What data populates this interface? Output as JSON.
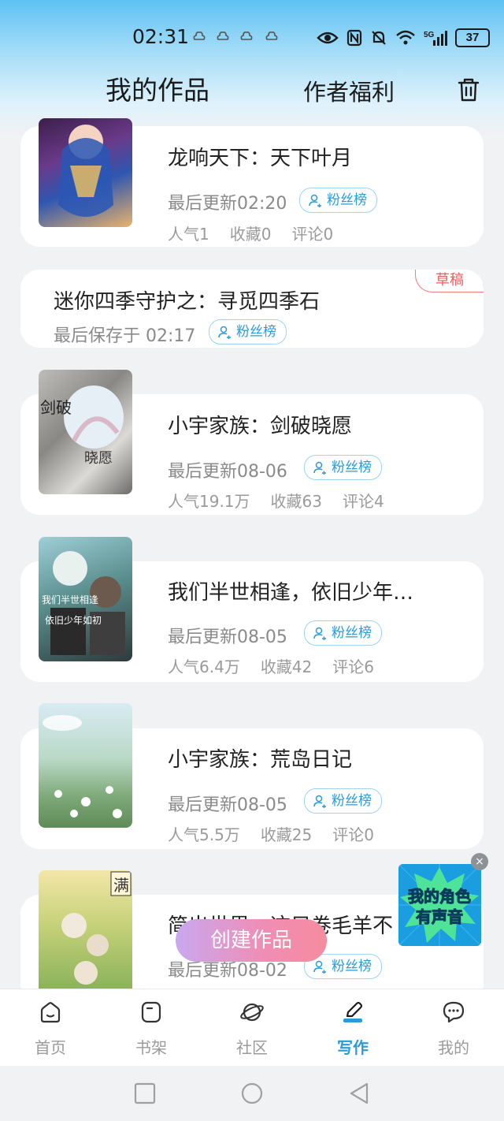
{
  "status_bar": {
    "time": "02:31",
    "battery": "37",
    "icons": [
      "notification-icon",
      "notification-icon",
      "notification-icon",
      "notification-icon",
      "eye-icon",
      "nfc-icon",
      "mute-icon",
      "wifi-icon",
      "signal-5g-icon",
      "battery-icon"
    ]
  },
  "header": {
    "title": "我的作品",
    "benefit": "作者福利",
    "trash_icon": "trash-icon"
  },
  "works": [
    {
      "title": "龙响天下：天下叶月",
      "updated": "最后更新02:20",
      "fan": "粉丝榜",
      "popularity": "人气1",
      "favorites": "收藏0",
      "comments": "评论0"
    },
    {
      "title": "迷你四季守护之：寻觅四季石",
      "updated": "最后保存于 02:17",
      "fan": "粉丝榜",
      "badge": "草稿"
    },
    {
      "title": "小宇家族：剑破晓愿",
      "updated": "最后更新08-06",
      "fan": "粉丝榜",
      "popularity": "人气19.1万",
      "favorites": "收藏63",
      "comments": "评论4",
      "cover_text": "剑破",
      "cover_text2": "晓愿"
    },
    {
      "title": "我们半世相逢，依旧少年…",
      "updated": "最后更新08-05",
      "fan": "粉丝榜",
      "popularity": "人气6.4万",
      "favorites": "收藏42",
      "comments": "评论6",
      "cover_text": "我们半世相逢",
      "cover_text2": "依旧少年如初"
    },
    {
      "title": "小宇家族：荒岛日记",
      "updated": "最后更新08-05",
      "fan": "粉丝榜",
      "popularity": "人气5.5万",
      "favorites": "收藏25",
      "comments": "评论0"
    },
    {
      "title": "简出世界，这只卷毛羊不",
      "updated": "最后更新08-02",
      "fan": "粉丝榜",
      "cover_text": "满"
    }
  ],
  "create_button": "创建作品",
  "ad": {
    "line1": "我的角色",
    "line2": "有声音",
    "close": "×"
  },
  "nav": [
    {
      "label": "首页",
      "icon": "home-icon"
    },
    {
      "label": "书架",
      "icon": "bookshelf-icon"
    },
    {
      "label": "社区",
      "icon": "planet-icon"
    },
    {
      "label": "写作",
      "icon": "pen-icon",
      "active": true
    },
    {
      "label": "我的",
      "icon": "chat-bubble-icon"
    }
  ],
  "colors": {
    "accent": "#2b9bd8",
    "draft": "#ee5d5d",
    "header_top": "#5ec2f4"
  }
}
